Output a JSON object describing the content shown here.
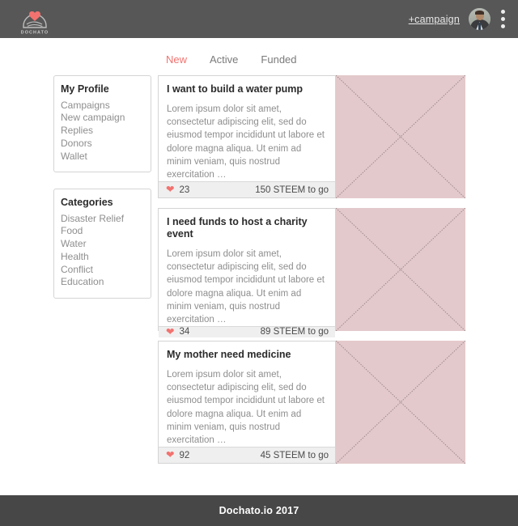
{
  "header": {
    "logo_text": "DOCHATO",
    "logo_icon": "heart-hand-logo",
    "campaign_link": "+campaign",
    "avatar_icon": "user-avatar",
    "menu_icon": "kebab-menu-icon"
  },
  "tabs": [
    {
      "label": "New",
      "active": true
    },
    {
      "label": "Active",
      "active": false
    },
    {
      "label": "Funded",
      "active": false
    }
  ],
  "sidebar": {
    "profile_panel": {
      "title": "My Profile",
      "items": [
        "Campaigns",
        "New campaign",
        "Replies",
        "Donors",
        "Wallet"
      ]
    },
    "categories_panel": {
      "title": "Categories",
      "items": [
        "Disaster Relief",
        "Food",
        "Water",
        "Health",
        "Conflict",
        "Education"
      ]
    }
  },
  "cards": [
    {
      "title": "I want to build a water pump",
      "text": "Lorem ipsum dolor sit amet, consectetur adipiscing elit, sed do eiusmod tempor incididunt ut labore et dolore magna aliqua. Ut enim ad minim veniam, quis nostrud exercitation …",
      "likes": "23",
      "goal": "150 STEEM to go",
      "heart_icon": "heart-icon",
      "image_icon": "image-placeholder"
    },
    {
      "title": "I need funds to host a charity event",
      "text": "Lorem ipsum dolor sit amet, consectetur adipiscing elit, sed do eiusmod tempor incididunt ut labore et dolore magna aliqua. Ut enim ad minim veniam, quis nostrud exercitation …",
      "likes": "34",
      "goal": "89 STEEM to go",
      "heart_icon": "heart-icon",
      "image_icon": "image-placeholder"
    },
    {
      "title": "My mother need medicine",
      "text": "Lorem ipsum dolor sit amet, consectetur adipiscing elit, sed do eiusmod tempor incididunt ut labore et dolore magna aliqua. Ut enim ad minim veniam, quis nostrud exercitation …",
      "likes": "92",
      "goal": "45 STEEM to go",
      "heart_icon": "heart-icon",
      "image_icon": "image-placeholder"
    }
  ],
  "footer": {
    "text": "Dochato.io 2017"
  },
  "colors": {
    "header_bg": "#575757",
    "footer_bg": "#474747",
    "accent": "#f2736f",
    "image_placeholder": "#e3c9cb"
  }
}
